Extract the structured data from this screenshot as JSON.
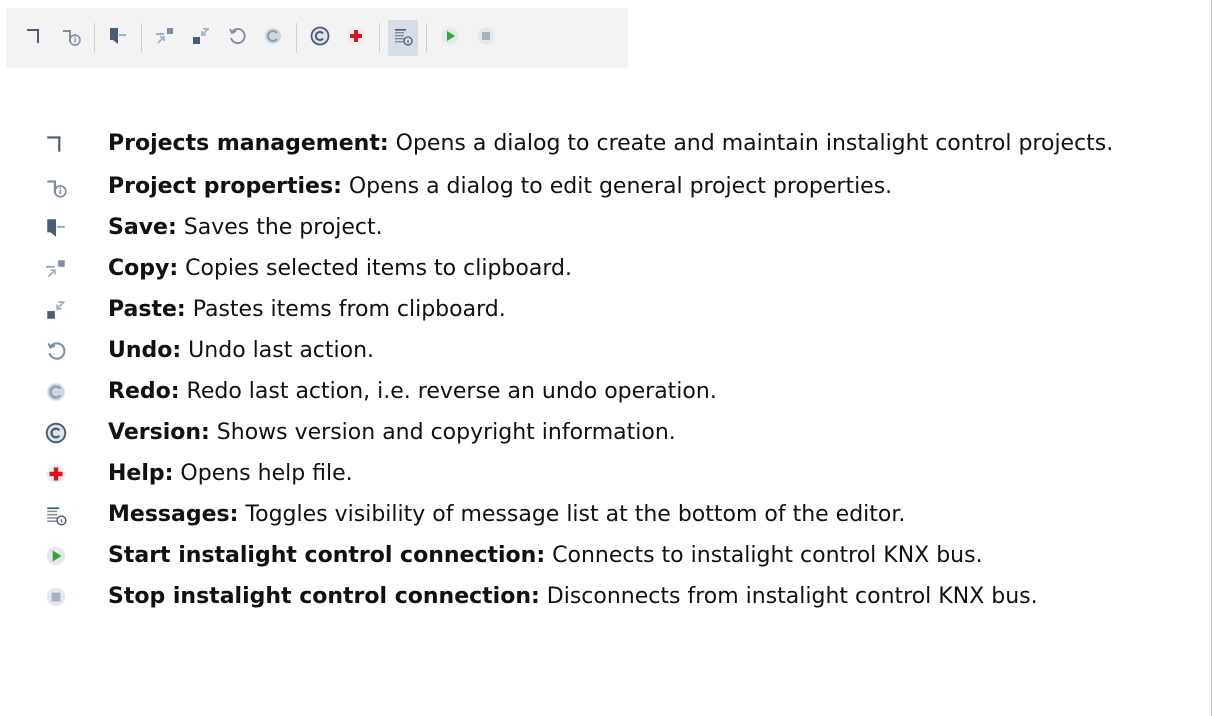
{
  "toolbar": {
    "buttons": [
      {
        "icon": "projects-management-icon"
      },
      {
        "icon": "project-properties-icon"
      },
      {
        "icon": "save-icon"
      },
      {
        "icon": "copy-icon"
      },
      {
        "icon": "paste-icon"
      },
      {
        "icon": "undo-icon"
      },
      {
        "icon": "redo-icon"
      },
      {
        "icon": "version-icon"
      },
      {
        "icon": "help-icon"
      },
      {
        "icon": "messages-icon"
      },
      {
        "icon": "start-connection-icon"
      },
      {
        "icon": "stop-connection-icon"
      }
    ]
  },
  "items": [
    {
      "term": "Projects management:",
      "text": " Opens a dialog to create and maintain instalight control projects.",
      "icon": "projects-management-icon"
    },
    {
      "term": "Project properties:",
      "text": " Opens a dialog to edit general project properties.",
      "icon": "project-properties-icon"
    },
    {
      "term": "Save:",
      "text": " Saves the project.",
      "icon": "save-icon"
    },
    {
      "term": "Copy:",
      "text": " Copies selected items to clipboard.",
      "icon": "copy-icon"
    },
    {
      "term": "Paste:",
      "text": " Pastes items from clipboard.",
      "icon": "paste-icon"
    },
    {
      "term": "Undo:",
      "text": " Undo last action.",
      "icon": "undo-icon"
    },
    {
      "term": "Redo:",
      "text": " Redo last action, i.e. reverse an undo operation.",
      "icon": "redo-icon"
    },
    {
      "term": "Version:",
      "text": " Shows version and copyright information.",
      "icon": "version-icon"
    },
    {
      "term": "Help:",
      "text": " Opens help file.",
      "icon": "help-icon"
    },
    {
      "term": "Messages:",
      "text": " Toggles visibility of message list at the bottom of the editor.",
      "icon": "messages-icon"
    },
    {
      "term": "Start instalight control connection:",
      "text": " Connects to instalight control KNX bus.",
      "icon": "start-connection-icon"
    },
    {
      "term": "Stop instalight control connection:",
      "text": " Disconnects from instalight control KNX bus.",
      "icon": "stop-connection-icon"
    }
  ],
  "colors": {
    "toolbar_bg": "#f3f3f3",
    "icon_dark": "#4a5d78",
    "icon_light": "#9fb0c6",
    "help_red": "#d9141c",
    "start_green": "#2fa82f"
  }
}
